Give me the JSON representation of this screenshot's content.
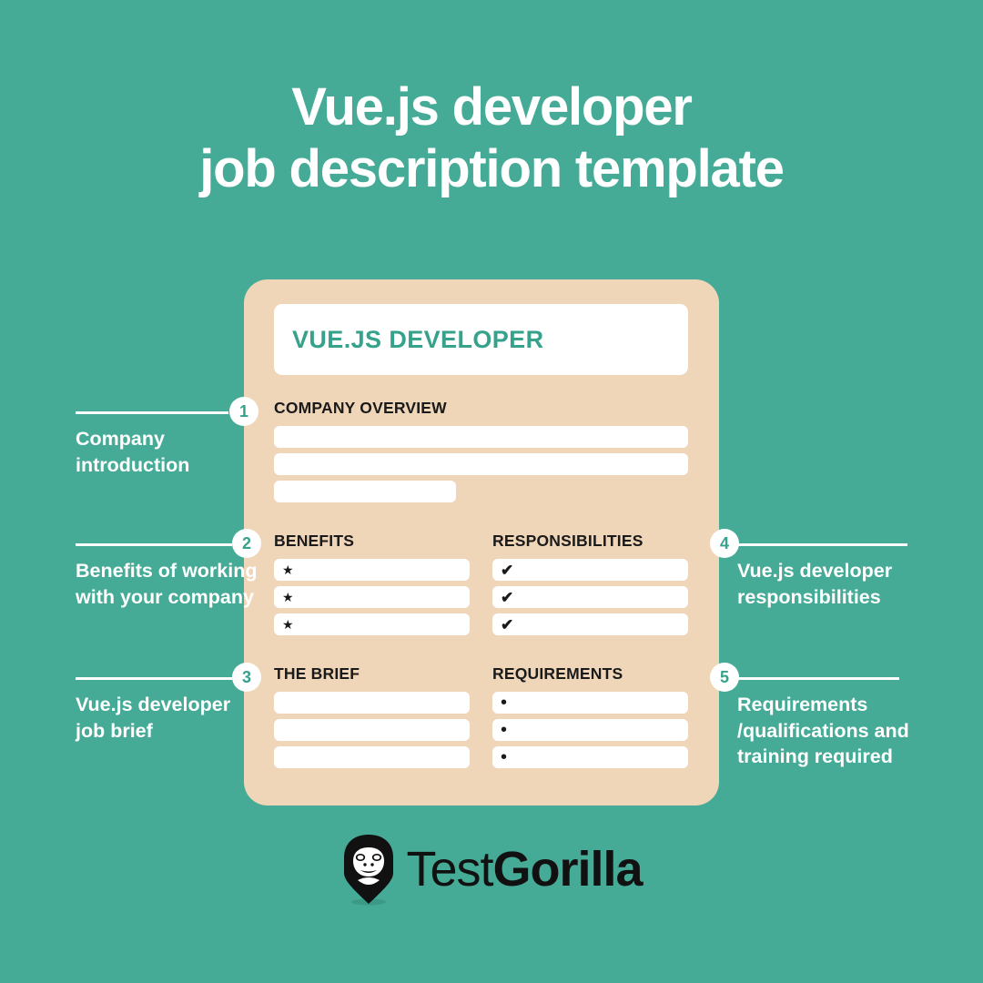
{
  "title": {
    "line1": "Vue.js developer",
    "line2": "job description template"
  },
  "colors": {
    "background_teal": "#45ab97",
    "card_peach": "#f0d6b8",
    "accent_green": "#36a28b",
    "white": "#ffffff",
    "text_black": "#1a1a1a"
  },
  "card": {
    "header": "VUE.JS DEVELOPER",
    "sections": [
      {
        "id": "overview",
        "label": "COMPANY OVERVIEW",
        "marker": "none",
        "rows": [
          "",
          "",
          ""
        ]
      },
      {
        "id": "benefits",
        "label": "BENEFITS",
        "marker": "star",
        "marker_glyph": "★",
        "rows": [
          "",
          "",
          ""
        ]
      },
      {
        "id": "responsibilities",
        "label": "RESPONSIBILITIES",
        "marker": "check",
        "marker_glyph": "✔",
        "rows": [
          "",
          "",
          ""
        ]
      },
      {
        "id": "brief",
        "label": "THE BRIEF",
        "marker": "none",
        "rows": [
          "",
          "",
          ""
        ]
      },
      {
        "id": "requirements",
        "label": "REQUIREMENTS",
        "marker": "dot",
        "marker_glyph": "•",
        "rows": [
          "",
          "",
          ""
        ]
      }
    ]
  },
  "callouts": [
    {
      "number": "1",
      "side": "left",
      "text": "Company introduction"
    },
    {
      "number": "2",
      "side": "left",
      "text": "Benefits of working with your company"
    },
    {
      "number": "3",
      "side": "left",
      "text": "Vue.js developer job brief"
    },
    {
      "number": "4",
      "side": "right",
      "text": "Vue.js developer responsibilities"
    },
    {
      "number": "5",
      "side": "right",
      "text": "Requirements /qualifications and training required"
    }
  ],
  "logo": {
    "icon": "gorilla-shield-icon",
    "word_light": "Test",
    "word_bold": "Gorilla"
  }
}
